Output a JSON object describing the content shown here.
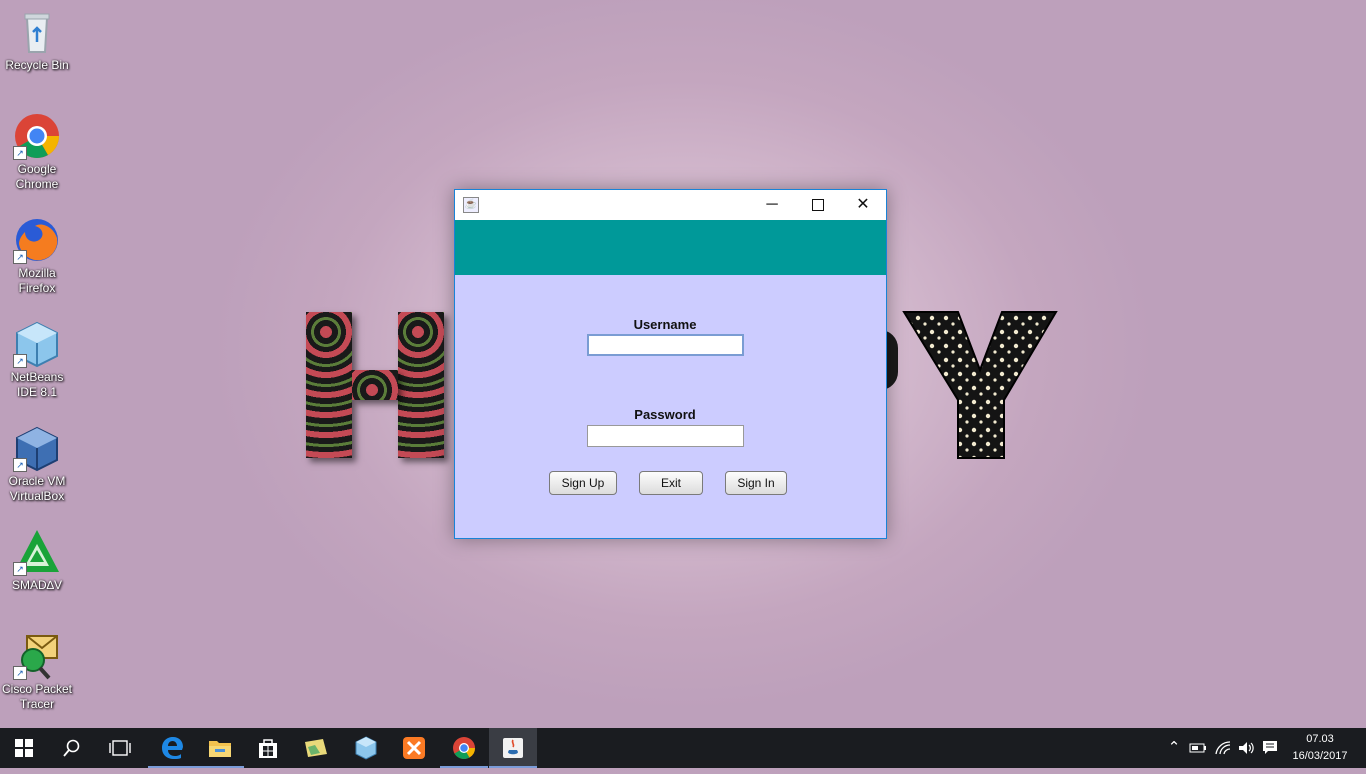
{
  "desktop": {
    "icons": [
      {
        "label": "Recycle Bin",
        "icon": "recycle-bin-icon"
      },
      {
        "label": "Google Chrome",
        "icon": "chrome-icon"
      },
      {
        "label": "Mozilla Firefox",
        "icon": "firefox-icon"
      },
      {
        "label": "NetBeans IDE 8.1",
        "icon": "netbeans-icon"
      },
      {
        "label": "Oracle VM VirtualBox",
        "icon": "virtualbox-icon"
      },
      {
        "label": "SMAD∆V",
        "icon": "smadav-icon"
      },
      {
        "label": "Cisco Packet Tracer",
        "icon": "packet-tracer-icon"
      }
    ]
  },
  "login_window": {
    "title": "",
    "header_color": "#009999",
    "body_color": "#ccccff",
    "username_label": "Username",
    "username_value": "",
    "password_label": "Password",
    "password_value": "",
    "buttons": {
      "sign_up": "Sign Up",
      "exit": "Exit",
      "sign_in": "Sign In"
    }
  },
  "taskbar": {
    "apps": [
      "start",
      "search",
      "task-view",
      "edge",
      "file-explorer",
      "store",
      "photos",
      "netbeans",
      "xampp",
      "chrome",
      "java"
    ],
    "active_app": "java",
    "clock": {
      "time": "07.03",
      "date": "16/03/2017"
    }
  }
}
